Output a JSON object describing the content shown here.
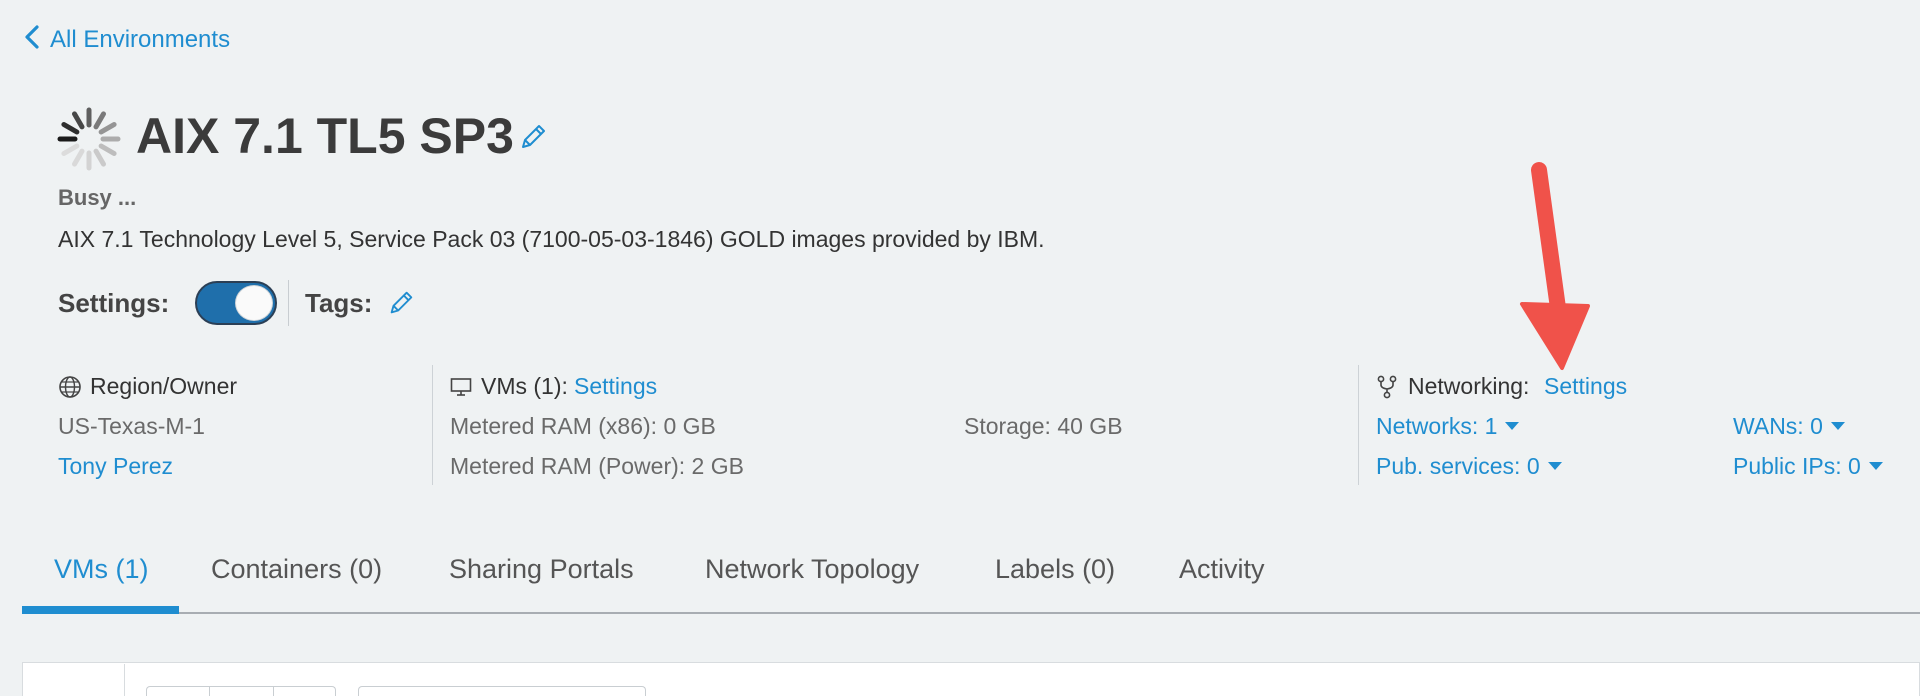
{
  "back_link": {
    "label": "All Environments"
  },
  "environment": {
    "title": "AIX 7.1 TL5 SP3",
    "status": "Busy ...",
    "description": "AIX 7.1 Technology Level 5, Service Pack 03 (7100-05-03-1846) GOLD images provided by IBM."
  },
  "settings": {
    "label": "Settings:",
    "toggle_on": true
  },
  "tags": {
    "label": "Tags:"
  },
  "region": {
    "heading": "Region/Owner",
    "region": "US-Texas-M-1",
    "owner": "Tony Perez"
  },
  "vms": {
    "heading": "VMs (1):",
    "settings_link": "Settings",
    "metered_ram_x86": "Metered RAM (x86): 0 GB",
    "metered_ram_power": "Metered RAM (Power): 2 GB",
    "storage": "Storage: 40 GB"
  },
  "networking": {
    "heading": "Networking:",
    "settings_link": "Settings",
    "networks": "Networks: 1",
    "pub_services": "Pub. services: 0",
    "wans": "WANs: 0",
    "public_ips": "Public IPs: 0"
  },
  "tabs": [
    {
      "label": "VMs (1)",
      "active": true
    },
    {
      "label": "Containers (0)",
      "active": false
    },
    {
      "label": "Sharing Portals",
      "active": false
    },
    {
      "label": "Network Topology",
      "active": false
    },
    {
      "label": "Labels (0)",
      "active": false
    },
    {
      "label": "Activity",
      "active": false
    }
  ],
  "colors": {
    "accent": "#1f8dd0",
    "background": "#eff2f3",
    "toggle": "#1f6fab",
    "annotation_arrow": "#f0524a"
  },
  "icons": {
    "back": "chevron-left-icon",
    "spinner": "loading-spinner-icon",
    "edit": "pencil-icon",
    "region": "globe-icon",
    "vms": "monitor-icon",
    "networking": "network-fork-icon",
    "dropdown": "caret-down-icon",
    "annotation": "red-arrow-icon"
  }
}
